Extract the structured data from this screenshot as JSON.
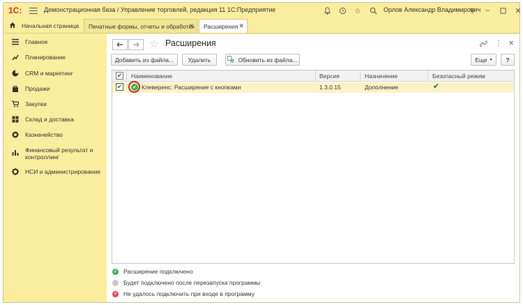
{
  "app": {
    "logo_text": "1С:",
    "title": "Демонстрационная база / Управление торговлей, редакция 11 1С:Предприятие",
    "user": "Орлов Александр Владимирович",
    "accent_color": "#fbed9e"
  },
  "tabs": [
    {
      "label": "Начальная страница"
    },
    {
      "label": "Печатные формы, отчеты и обработки",
      "close": "✕"
    },
    {
      "label": "Расширения",
      "close": "✕"
    }
  ],
  "sidebar": {
    "items": [
      {
        "label": "Главное",
        "icon": "menu-icon"
      },
      {
        "label": "Планирование",
        "icon": "chart-icon"
      },
      {
        "label": "CRM и маркетинг",
        "icon": "pie-icon"
      },
      {
        "label": "Продажи",
        "icon": "bag-icon"
      },
      {
        "label": "Закупки",
        "icon": "cart-icon"
      },
      {
        "label": "Склад и доставка",
        "icon": "warehouse-icon"
      },
      {
        "label": "Казначейство",
        "icon": "coin-icon"
      },
      {
        "label": "Финансовый результат и контроллинг",
        "icon": "bar-chart-icon"
      },
      {
        "label": "НСИ и администрирование",
        "icon": "gear-icon"
      }
    ]
  },
  "form": {
    "title": "Расширения",
    "buttons": {
      "add": "Добавить из файла...",
      "delete": "Удалить",
      "update": "Обновить из файла...",
      "more": "Еще",
      "help": "?"
    }
  },
  "table": {
    "columns": [
      "Наименование",
      "Версия",
      "Назначение",
      "Безопасный режим"
    ],
    "rows": [
      {
        "name": "Клеверенс: Расширение с кнопками",
        "version": "1.3.0.15",
        "purpose": "Дополнение",
        "safe_mode": true,
        "active": true
      }
    ]
  },
  "legend": [
    {
      "label": "Расширение подключено",
      "color": "#3cb15a"
    },
    {
      "label": "Будет подключено после перезапуска программы",
      "color": "#c8c8c8"
    },
    {
      "label": "Не удалось подключить при входе в программу",
      "color": "#e0474c"
    }
  ]
}
